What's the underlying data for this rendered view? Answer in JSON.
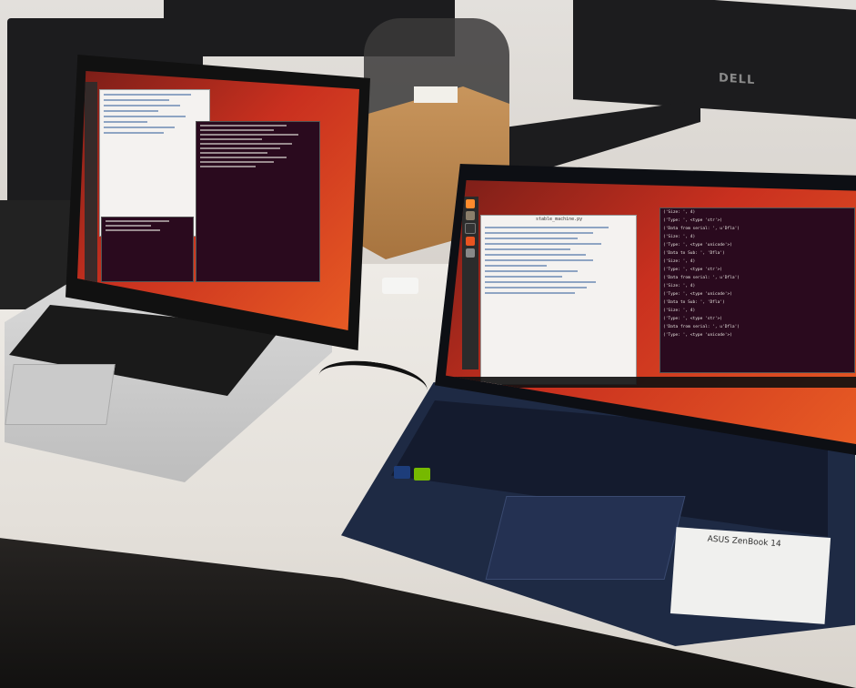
{
  "scene": {
    "description_elements": [
      "macbook",
      "zenbook",
      "dell-monitor",
      "desk"
    ]
  },
  "dell_monitor": {
    "logo": "DELL"
  },
  "macbook": {
    "screen": {
      "os": "ubuntu",
      "windows": [
        "editor",
        "terminal",
        "terminal"
      ]
    }
  },
  "zenbook": {
    "screen": {
      "os": "ubuntu",
      "editor_title": "stable_machine.py",
      "terminal_lines": [
        "('Size: ', 4)",
        "('Type: ', <type 'str'>)",
        "('Data from serial: ', u'Dfla')",
        "('Size: ', 4)",
        "('Type: ', <type 'unicode'>)",
        "('Data to Sub: ', 'Dfla')",
        "('Size: ', 4)",
        "('Type: ', <type 'str'>)",
        "('Data from serial: ', u'Dfla')",
        "('Size: ', 4)",
        "('Type: ', <type 'unicode'>)",
        "('Data to Sub: ', 'Dfla')",
        "('Size: ', 4)",
        "('Type: ', <type 'str'>)",
        "('Data from serial: ', u'Dfla')",
        "('Type: ', <type 'unicode'>)"
      ]
    },
    "label": {
      "brand": "ASUS ZenBook 14"
    }
  },
  "colors": {
    "ubuntu_orange": "#e85c24",
    "ubuntu_red": "#c9301f",
    "terminal_bg": "#2a0a1e",
    "zenbook_body": "#1e2a44"
  }
}
